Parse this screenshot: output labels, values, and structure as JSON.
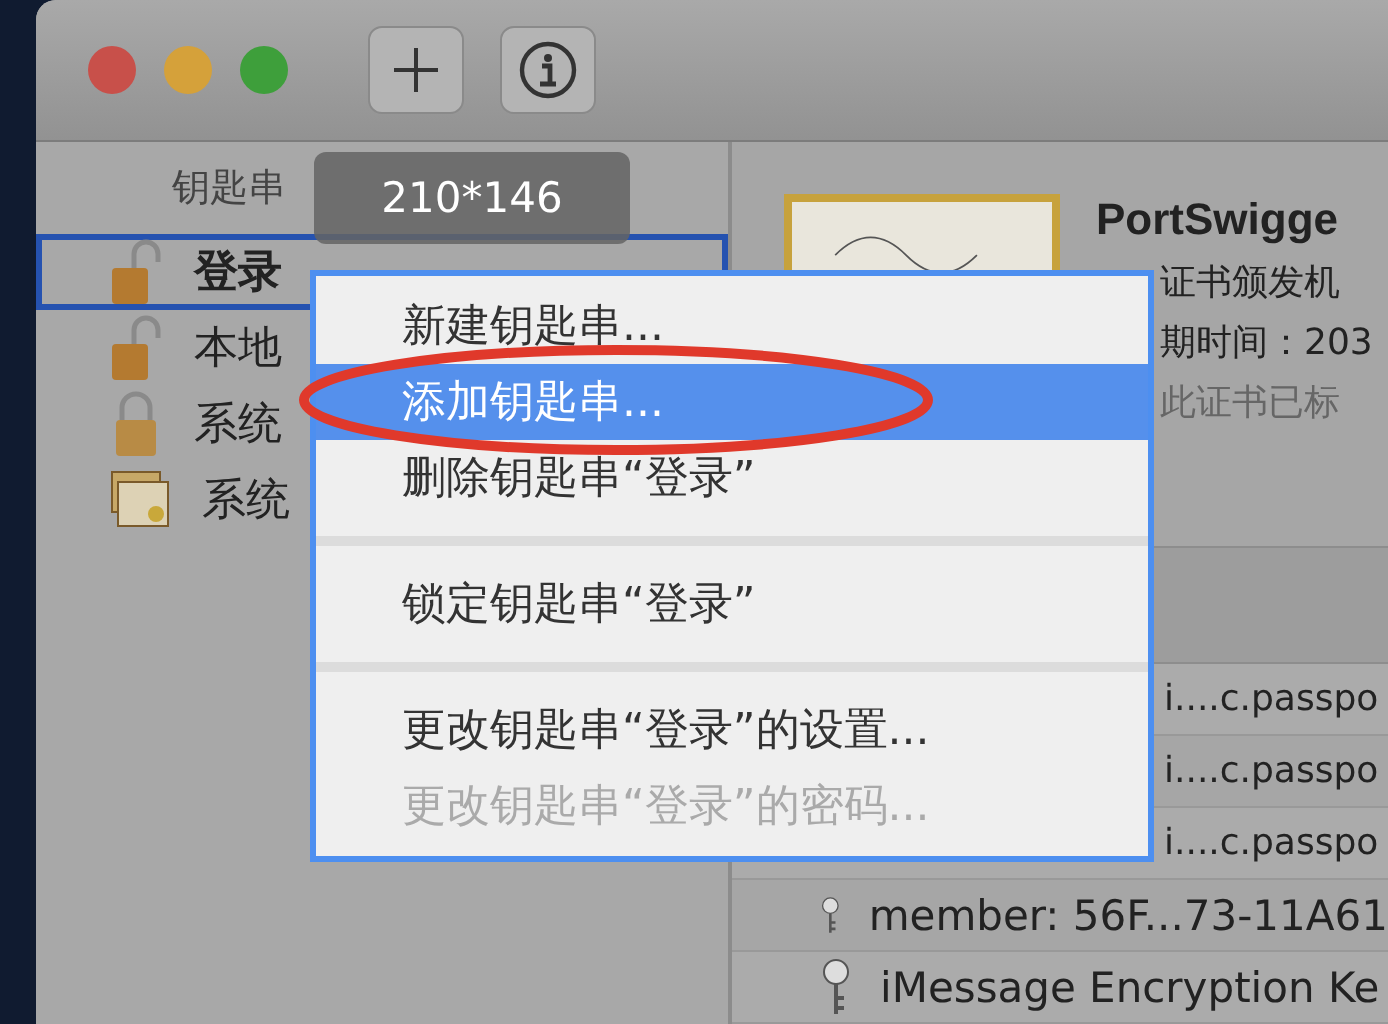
{
  "sidebar": {
    "header": "钥匙串",
    "items": [
      {
        "label": "登录",
        "kind": "unlocked",
        "selected": true
      },
      {
        "label": "本地",
        "kind": "unlocked",
        "selected": false
      },
      {
        "label": "系统",
        "kind": "locked",
        "selected": false
      },
      {
        "label": "系统",
        "kind": "certificates",
        "selected": false
      }
    ]
  },
  "size_badge": {
    "text": "210*146"
  },
  "detail": {
    "title": "PortSwigge",
    "lines": [
      {
        "text": "证书颁发机",
        "muted": false
      },
      {
        "text": "期时间：203",
        "muted": false
      },
      {
        "text": "此证书已标",
        "muted": true
      }
    ]
  },
  "items": [
    {
      "name": "i....c.passpo",
      "kind": "plain"
    },
    {
      "name": "i....c.passpo",
      "kind": "plain"
    },
    {
      "name": "i....c.passpo",
      "kind": "plain"
    },
    {
      "name": "member: 56F...73-11A61",
      "kind": "key"
    },
    {
      "name": "iMessage Encryption Ke",
      "kind": "key"
    }
  ],
  "context_menu": {
    "items": [
      {
        "kind": "item",
        "label": "新建钥匙串...",
        "selected": false,
        "disabled": false
      },
      {
        "kind": "item",
        "label": "添加钥匙串...",
        "selected": true,
        "disabled": false
      },
      {
        "kind": "item",
        "label": "删除钥匙串“登录”",
        "selected": false,
        "disabled": false
      },
      {
        "kind": "separator"
      },
      {
        "kind": "item",
        "label": "锁定钥匙串“登录”",
        "selected": false,
        "disabled": false
      },
      {
        "kind": "separator"
      },
      {
        "kind": "item",
        "label": "更改钥匙串“登录”的设置...",
        "selected": false,
        "disabled": false
      },
      {
        "kind": "item",
        "label": "更改钥匙串“登录”的密码...",
        "selected": false,
        "disabled": true
      }
    ]
  }
}
